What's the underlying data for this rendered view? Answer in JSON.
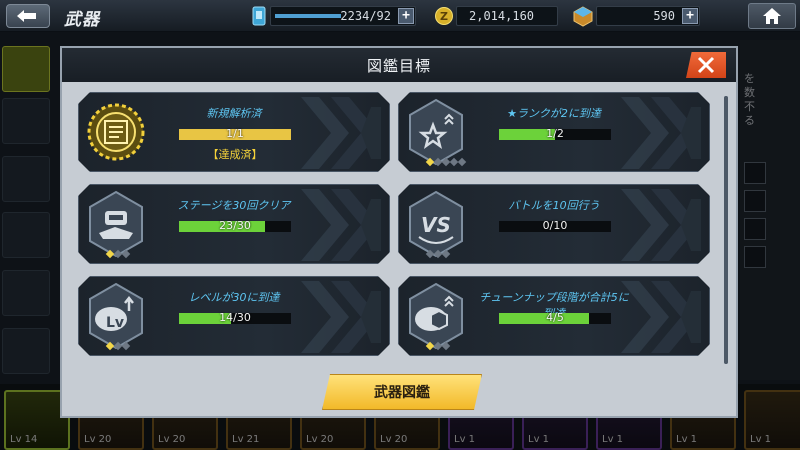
{
  "topbar": {
    "title": "武器",
    "capacity": "2234/92",
    "credits": "2,014,160",
    "gems": "590"
  },
  "background": {
    "right_text": "を 数 不 る"
  },
  "bottom_strip": {
    "levels": [
      "Lv 14",
      "Lv 20",
      "Lv 20",
      "Lv 21",
      "Lv 20",
      "Lv 20",
      "Lv 1",
      "Lv 1",
      "Lv 1",
      "Lv 1",
      "Lv 1"
    ]
  },
  "modal": {
    "title": "図鑑目標",
    "button_label": "武器図鑑",
    "cards": [
      {
        "title": "新規解析済",
        "progress_text": "1/1",
        "progress": 1.0,
        "status": "【達成済】",
        "icon": "analyzed-badge-icon",
        "stars_on": 0,
        "stars_total": 0,
        "bar_color": "#e8c544"
      },
      {
        "title": "★ランクが2に到達",
        "progress_text": "1/2",
        "progress": 0.5,
        "status": "",
        "icon": "star-rank-up-icon",
        "stars_on": 1,
        "stars_total": 5,
        "bar_color": "#6cd23a"
      },
      {
        "title": "ステージを30回クリア",
        "progress_text": "23/30",
        "progress": 0.7667,
        "status": "",
        "icon": "robot-pilot-icon",
        "stars_on": 1,
        "stars_total": 3,
        "bar_color": "#6cd23a"
      },
      {
        "title": "バトルを10回行う",
        "progress_text": "0/10",
        "progress": 0.0,
        "status": "",
        "icon": "versus-icon",
        "stars_on": 0,
        "stars_total": 3,
        "bar_color": "#6cd23a"
      },
      {
        "title": "レベルが30に到達",
        "progress_text": "14/30",
        "progress": 0.4667,
        "status": "",
        "icon": "level-up-icon",
        "stars_on": 1,
        "stars_total": 3,
        "bar_color": "#6cd23a"
      },
      {
        "title": "チューンナップ段階が合計5に到達",
        "progress_text": "4/5",
        "progress": 0.8,
        "status": "",
        "icon": "tuneup-icon",
        "stars_on": 1,
        "stars_total": 3,
        "bar_color": "#6cd23a"
      }
    ]
  },
  "colors": {
    "accent_blue": "#5ec6f2",
    "progress_green": "#6cd23a",
    "completed_gold": "#f4d23a",
    "close_orange": "#e8582a",
    "button_yellow": "#f7cb45"
  }
}
